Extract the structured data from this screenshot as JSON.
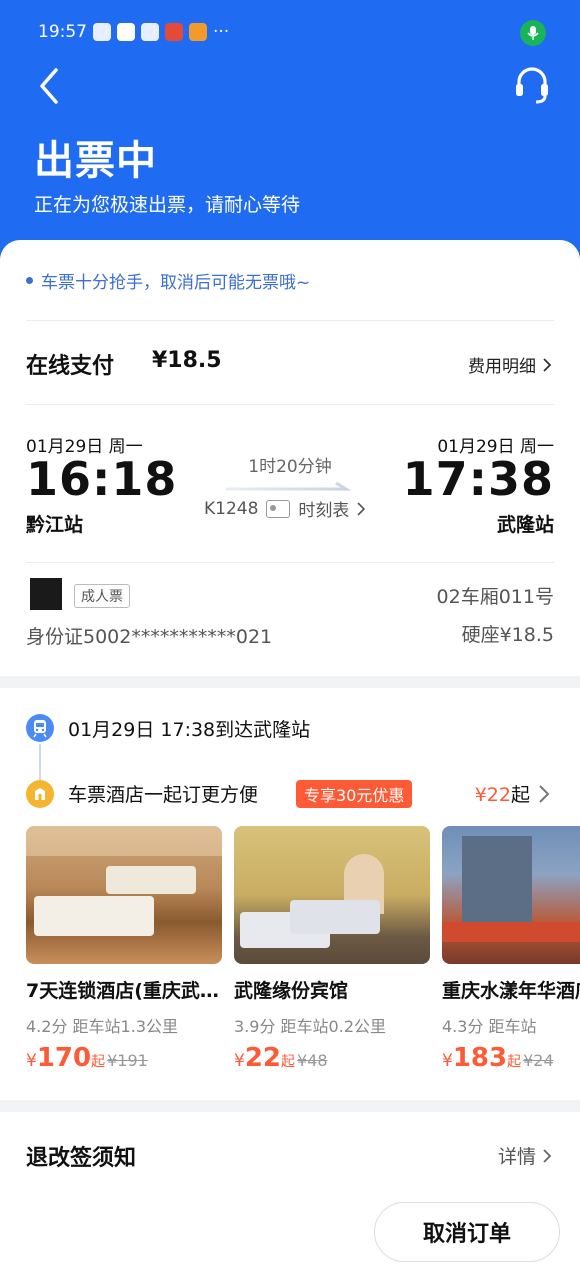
{
  "status_bar": {
    "time": "19:57",
    "more": "···"
  },
  "header": {
    "title": "出票中",
    "subtitle": "正在为您极速出票，请耐心等待"
  },
  "notice": "车票十分抢手，取消后可能无票哦~",
  "payment": {
    "label": "在线支付",
    "amount": "¥18.5",
    "fee_link": "费用明细"
  },
  "trip": {
    "departure": {
      "date": "01月29日 周一",
      "time": "16:18",
      "station": "黔江站"
    },
    "arrival": {
      "date": "01月29日 周一",
      "time": "17:38",
      "station": "武隆站"
    },
    "duration": "1时20分钟",
    "train_no": "K1248",
    "timetable": "时刻表"
  },
  "passenger": {
    "ticket_type": "成人票",
    "id_card": "身份证5002***********021",
    "car_seat": "02车厢011号",
    "seat_type": "硬座¥18.5"
  },
  "arrival_info": "01月29日 17:38到达武隆站",
  "hotel_section": {
    "text": "车票酒店一起订更方便",
    "promo": "专享30元优惠",
    "from_price": "¥22",
    "from_suffix": "起",
    "hotels": [
      {
        "name": "7天连锁酒店(重庆武隆…",
        "rating": "4.2分",
        "distance": "距车站1.3公里",
        "currency": "¥",
        "price": "170",
        "qi": "起",
        "old_price": "¥191"
      },
      {
        "name": "武隆缘份宾馆",
        "rating": "3.9分",
        "distance": "距车站0.2公里",
        "currency": "¥",
        "price": "22",
        "qi": "起",
        "old_price": "¥48"
      },
      {
        "name": "重庆水漾年华酒店",
        "rating": "4.3分",
        "distance": "距车站",
        "currency": "¥",
        "price": "183",
        "qi": "起",
        "old_price": "¥24"
      }
    ]
  },
  "rules": {
    "label": "退改签须知",
    "detail": "详情"
  },
  "cancel_button": "取消订单",
  "colors": {
    "brand_blue": "#1f6cf2",
    "accent_orange": "#ff5a36",
    "notice_blue": "#3b6fd1"
  },
  "icons": [
    "back-icon",
    "headset-icon",
    "microphone-icon",
    "chevron-right-icon",
    "id-card-icon",
    "train-icon",
    "hotel-icon"
  ]
}
